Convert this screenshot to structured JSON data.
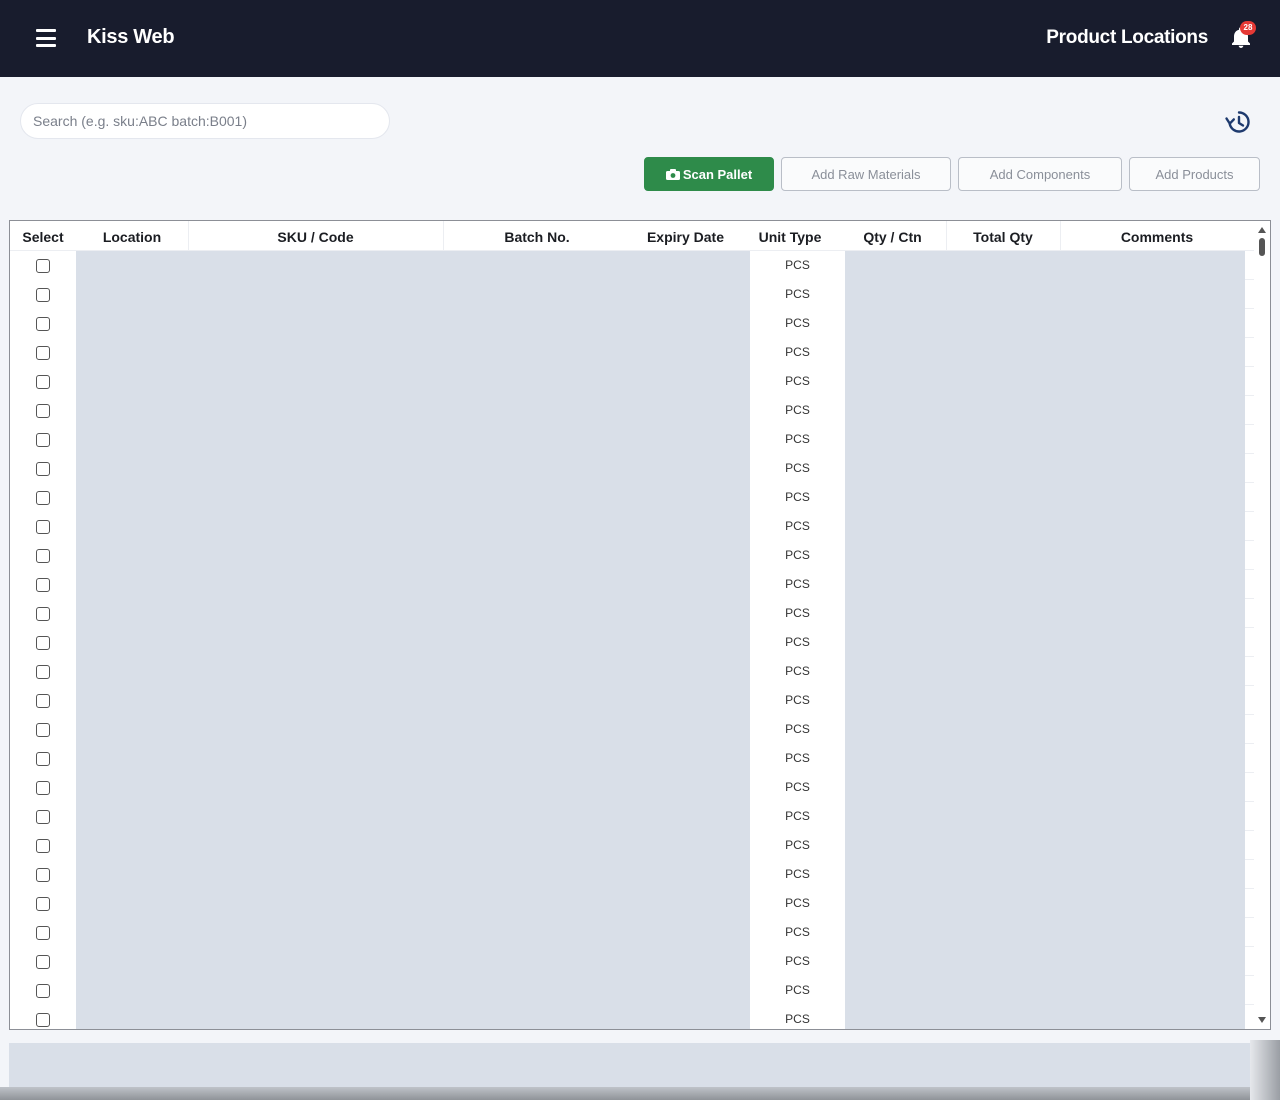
{
  "header": {
    "app_title": "Kiss Web",
    "page_title": "Product Locations",
    "notification_count": "28",
    "background": "#181c2d"
  },
  "search": {
    "placeholder": "Search (e.g. sku:ABC batch:B001)",
    "value": ""
  },
  "toolbar": {
    "scan_pallet_label": "Scan Pallet",
    "add_raw_materials_label": "Add Raw Materials",
    "add_components_label": "Add Components",
    "add_products_label": "Add Products",
    "accent": "#2e8b4a"
  },
  "table": {
    "columns": [
      "Select",
      "Location",
      "SKU / Code",
      "Batch No.",
      "Expiry Date",
      "Unit Type",
      "Qty / Ctn",
      "Total Qty",
      "Comments"
    ],
    "rows": [
      {
        "unit": "PCS"
      },
      {
        "unit": "PCS"
      },
      {
        "unit": "PCS"
      },
      {
        "unit": "PCS"
      },
      {
        "unit": "PCS"
      },
      {
        "unit": "PCS"
      },
      {
        "unit": "PCS"
      },
      {
        "unit": "PCS"
      },
      {
        "unit": "PCS"
      },
      {
        "unit": "PCS"
      },
      {
        "unit": "PCS"
      },
      {
        "unit": "PCS"
      },
      {
        "unit": "PCS"
      },
      {
        "unit": "PCS"
      },
      {
        "unit": "PCS"
      },
      {
        "unit": "PCS"
      },
      {
        "unit": "PCS"
      },
      {
        "unit": "PCS"
      },
      {
        "unit": "PCS"
      },
      {
        "unit": "PCS"
      },
      {
        "unit": "PCS"
      },
      {
        "unit": "PCS"
      },
      {
        "unit": "PCS"
      },
      {
        "unit": "PCS"
      },
      {
        "unit": "PCS"
      },
      {
        "unit": "PCS"
      },
      {
        "unit": "PCS"
      }
    ],
    "row_checked": false,
    "shaded_cell_color": "#d9dfe8"
  },
  "icons": {
    "menu": "hamburger-icon",
    "notifications": "bell-icon",
    "history": "history-icon",
    "scan": "camera-icon"
  }
}
